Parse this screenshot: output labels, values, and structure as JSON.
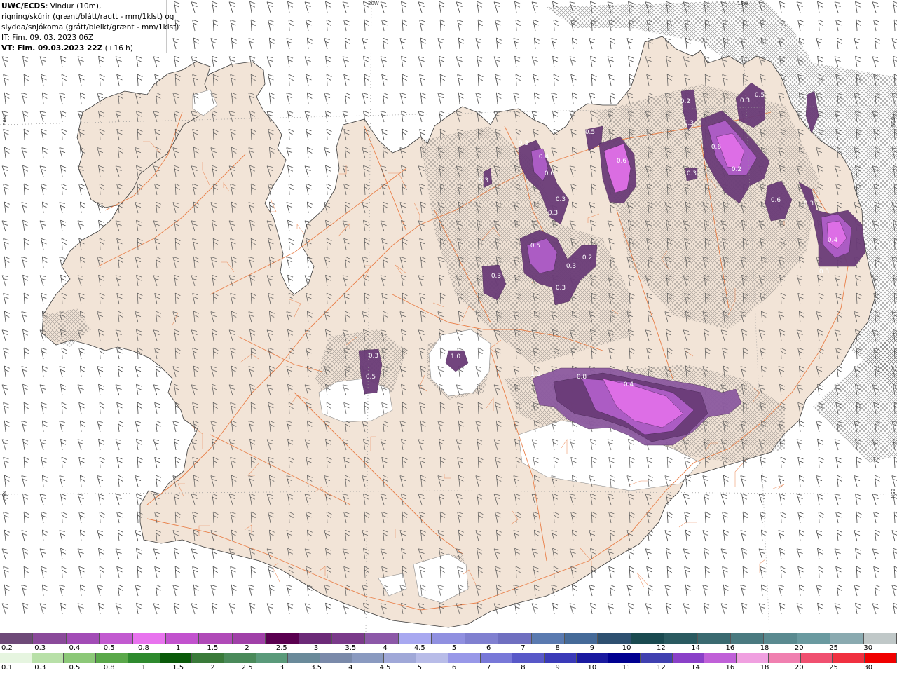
{
  "header": {
    "source": "UWC/ECDS",
    "line1_rest": ": Vindur (10m),",
    "line2": "rigning/skúrir (grænt/blátt/rautt - mm/1klst) og",
    "line3": "slydda/snjókoma (grátt/bleikt/grænt - mm/1klst)",
    "line4": "IT: Fim. 09. 03. 2023 06Z",
    "vt_label": "VT: Fim. 09.03.2023 22Z",
    "vt_offset": " (+16 h)"
  },
  "graticule": {
    "top_labels": [
      "20W",
      "15W"
    ],
    "left_labels": [
      "66N",
      "65N"
    ],
    "right_labels": [
      "66N",
      "65N"
    ]
  },
  "colors": {
    "sea": "#ffffff",
    "land": "#f2e4d7",
    "roads": "#e8743a",
    "glacier": "#ffffff",
    "precip_levels": [
      "#8c5aa0",
      "#6b3c78",
      "#b05ec8",
      "#e070e8"
    ]
  },
  "precip_labels": [
    "0.3",
    "0.4",
    "0.6",
    "0.3",
    "0.3",
    "0.3",
    "0.5",
    "0.3",
    "0.3",
    "0.2",
    "0.3",
    "0.6",
    "0.5",
    "0.6",
    "0.2",
    "0.3",
    "0.2",
    "0.3",
    "0.5",
    "0.3",
    "0.6",
    "0.3",
    "0.4",
    "0.3",
    "0.3",
    "0.5",
    "1.0",
    "1.0",
    "0.8",
    "0.4"
  ],
  "legend_snow": {
    "colors": [
      "#6e4a78",
      "#8a4a9a",
      "#a24cb6",
      "#c25ad0",
      "#e873ee",
      "#c252ce",
      "#b04ab8",
      "#a040a8",
      "#5a0050",
      "#6c2a78",
      "#7a3a8a",
      "#8c58a8",
      "#a8a8f0",
      "#9090e0",
      "#8080d0",
      "#6f6fc0",
      "#5a7ab0",
      "#456a98",
      "#2e5070",
      "#1a4a50",
      "#2a5a60",
      "#3a6a70",
      "#4a7a80",
      "#5a8a90",
      "#6a9aa0",
      "#8aaab0",
      "#c0c8c8"
    ],
    "labels": [
      "0.2",
      "0.3",
      "0.4",
      "0.5",
      "0.8",
      "1",
      "1.5",
      "2",
      "2.5",
      "3",
      "3.5",
      "4",
      "4.5",
      "5",
      "6",
      "7",
      "8",
      "9",
      "10",
      "12",
      "14",
      "16",
      "18",
      "20",
      "25",
      "30"
    ]
  },
  "legend_rain": {
    "colors": [
      "#e6f5e0",
      "#b8e0a8",
      "#8cc878",
      "#5aa84a",
      "#2e8a2e",
      "#0a5a0a",
      "#3a7a3a",
      "#4a8a5a",
      "#5a9a7a",
      "#6a8a9a",
      "#7a8aaa",
      "#8a9ac0",
      "#a0a8d8",
      "#b8bce8",
      "#9898e8",
      "#7878d8",
      "#5858c8",
      "#3a3ab8",
      "#1a1aa0",
      "#000090",
      "#4040b0",
      "#8a40c8",
      "#c060d8",
      "#f0a0e0",
      "#f080b0",
      "#f05070",
      "#f03040",
      "#f00000"
    ],
    "labels": [
      "0.1",
      "0.3",
      "0.5",
      "0.8",
      "1",
      "1.5",
      "2",
      "2.5",
      "3",
      "3.5",
      "4",
      "4.5",
      "5",
      "6",
      "7",
      "8",
      "9",
      "10",
      "11",
      "12",
      "14",
      "16",
      "18",
      "20",
      "25",
      "30"
    ]
  }
}
